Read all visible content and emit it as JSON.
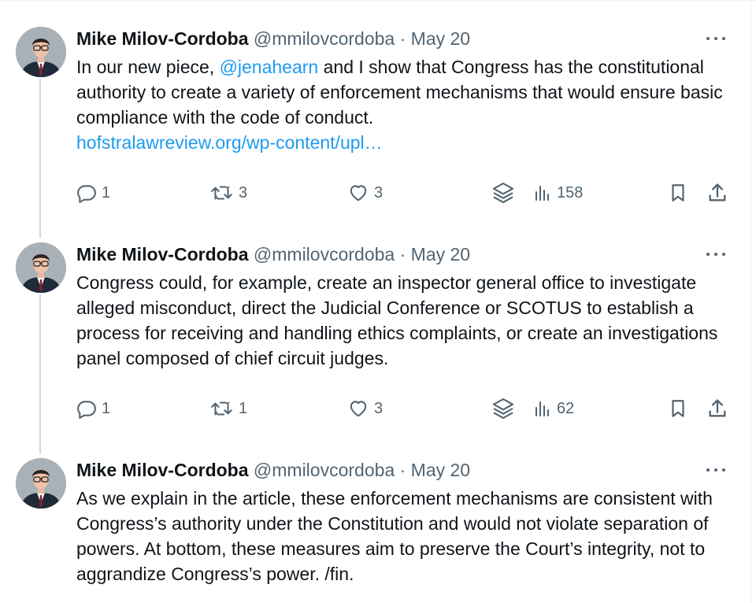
{
  "tweets": [
    {
      "name": "Mike Milov-Cordoba",
      "handle": "@mmilovcordoba",
      "separator": "·",
      "date": "May 20",
      "text_before_mention": "In our new piece, ",
      "mention": "@jenahearn",
      "text_after_mention": " and I show that Congress has the constitutional authority to create a variety of enforcement mechanisms that would ensure basic compliance with the code of conduct.",
      "link": "hofstralawreview.org/wp-content/upl…",
      "replies": "1",
      "reposts": "3",
      "likes": "3",
      "views": "158"
    },
    {
      "name": "Mike Milov-Cordoba",
      "handle": "@mmilovcordoba",
      "separator": "·",
      "date": "May 20",
      "text": "Congress could, for example, create an inspector general office to investigate alleged misconduct, direct the Judicial Conference or SCOTUS to establish a process for receiving and handling ethics complaints, or create an investigations panel composed of chief circuit judges.",
      "replies": "1",
      "reposts": "1",
      "likes": "3",
      "views": "62"
    },
    {
      "name": "Mike Milov-Cordoba",
      "handle": "@mmilovcordoba",
      "separator": "·",
      "date": "May 20",
      "text": "As we explain in the article, these enforcement mechanisms are consistent with Congress’s authority under the Constitution and would not violate separation of powers. At bottom, these measures aim to preserve the Court’s integrity, not to aggrandize Congress’s power. /fin."
    }
  ],
  "icons": [
    "reply-icon",
    "repost-icon",
    "like-icon",
    "stack-icon",
    "views-icon",
    "bookmark-icon",
    "share-icon",
    "more-icon"
  ],
  "colors": {
    "text": "#0f1419",
    "secondary": "#536471",
    "link": "#1d9bf0",
    "thread_line": "#cfd9de"
  }
}
